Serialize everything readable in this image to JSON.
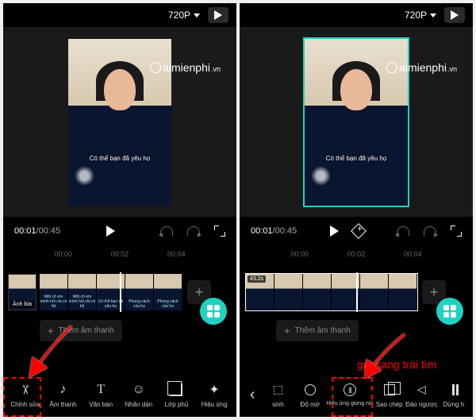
{
  "resolution": "720P",
  "time_current": "00:01",
  "time_total": "00:45",
  "caption_text": "Có thể bạn đã yêu họ",
  "watermark": "aimienphi",
  "watermark_suffix": ".vn",
  "ticks": [
    "00:00",
    "00:02",
    "00:04"
  ],
  "duration_badge": "43.2s",
  "cover_label": "Ảnh bìa",
  "add_audio": "Thêm âm thanh",
  "annotation": "gạt sang trái tìm",
  "toolbar_left": [
    {
      "label": "Chỉnh sửa",
      "icon": "scissors"
    },
    {
      "label": "Âm thanh",
      "icon": "note"
    },
    {
      "label": "Văn bản",
      "icon": "text"
    },
    {
      "label": "Nhãn dán",
      "icon": "sticker"
    },
    {
      "label": "Lớp phủ",
      "icon": "overlay"
    },
    {
      "label": "Hiệu ứng",
      "icon": "effect"
    }
  ],
  "toolbar_right": [
    {
      "label": "sinh",
      "icon": "res"
    },
    {
      "label": "Độ mờ",
      "icon": "blur"
    },
    {
      "label": "Hiệu ứng giọng nói",
      "icon": "voice"
    },
    {
      "label": "Sao chép",
      "icon": "copy"
    },
    {
      "label": "Đảo ngược",
      "icon": "reverse"
    },
    {
      "label": "Dừng h",
      "icon": "freeze"
    }
  ]
}
